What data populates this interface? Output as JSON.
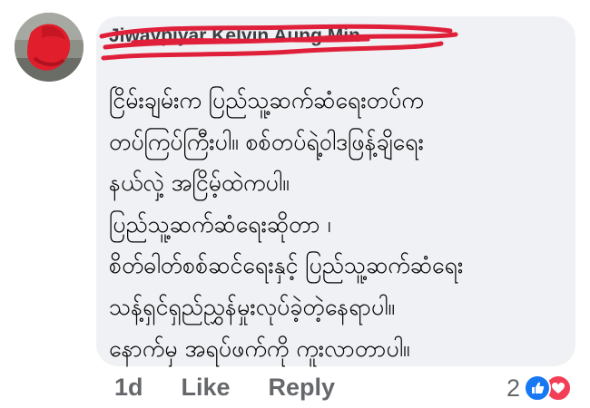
{
  "comment": {
    "author_name": "Jiwaypiyar Kelvin Aung Min",
    "text_lines": [
      "ငြိမ်းချမ်းက ပြည်သူ့ဆက်ဆံရေးတပ်က",
      "တပ်ကြပ်ကြီးပါ။ စစ်တပ်ရဲ့ဝါဒဖြန့်ချိရေး",
      "နယ်လှဲ့ အငြိမ့်ထဲကပါ။",
      "ပြည်သူ့ဆက်ဆံရေးဆိုတာ ၊",
      "စိတ်ဓါတ်စစ်ဆင်ရေးနှင့် ပြည်သူ့ဆက်ဆံရေး",
      "သန့်ရှင်ရှည်ညွှန်မှုးလုပ်ခဲ့တဲ့နေရာပါ။",
      "နောက်မှ အရပ်ဖက်ကို ကူးလာတာပါ။"
    ]
  },
  "actions": {
    "time": "1d",
    "like_label": "Like",
    "reply_label": "Reply"
  },
  "reactions": {
    "count": "2",
    "icons": [
      "like-reaction-icon",
      "love-reaction-icon"
    ],
    "like_color": "#1877f2",
    "love_color": "#f33e58"
  },
  "colors": {
    "bubble": "#eff1f4",
    "redaction": "#e0203a",
    "action_text": "#65676b"
  }
}
